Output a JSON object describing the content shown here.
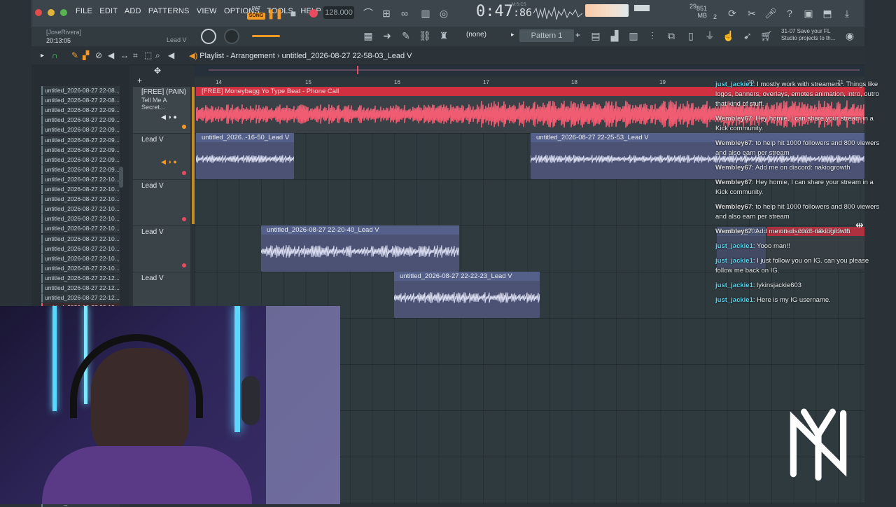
{
  "menu": [
    "FILE",
    "EDIT",
    "ADD",
    "PATTERNS",
    "VIEW",
    "OPTIONS",
    "TOOLS",
    "HELP"
  ],
  "transport": {
    "pat_label": "PAT",
    "song_label": "SONG",
    "tempo": "128.000",
    "time_main": "0:47",
    "time_sub": ":86",
    "time_unit": "M:S:CS"
  },
  "memory": {
    "cpu": "29",
    "mb": "851 MB",
    "voices": "2"
  },
  "user": {
    "name": "[JoseRivera]",
    "clock": "20:13:05"
  },
  "channel_label": "Lead V",
  "pattern_selector": "Pattern 1",
  "snap_selector": "(none)",
  "hint_text": "31-07  Save your FL Studio projects to th...",
  "playlist": {
    "view": "Playlist - Arrangement",
    "project": "untitled_2026-08-27 22-58-03_Lead V"
  },
  "browser_items": [
    "untitled_2026-08-27 22-08...",
    "untitled_2026-08-27 22-08...",
    "untitled_2026-08-27 22-09...",
    "untitled_2026-08-27 22-09...",
    "untitled_2026-08-27 22-09...",
    "untitled_2026-08-27 22-09...",
    "untitled_2026-08-27 22-09...",
    "untitled_2026-08-27 22-09...",
    "untitled_2026-08-27 22-09...",
    "untitled_2026-08-27 22-10...",
    "untitled_2026-08-27 22-10...",
    "untitled_2026-08-27 22-10...",
    "untitled_2026-08-27 22-10...",
    "untitled_2026-08-27 22-10...",
    "untitled_2026-08-27 22-10...",
    "untitled_2026-08-27 22-10...",
    "untitled_2026-08-27 22-10...",
    "untitled_2026-08-27 22-10...",
    "untitled_2026-08-27 22-10...",
    "untitled_2026-08-27 22-12...",
    "untitled_2026-08-27 22-12...",
    "untitled_2026-08-27 22-12...",
    "untitled_2026-08-27 22-12..."
  ],
  "browser_bottom_item": "untitled_2026-08-27 22-16...",
  "track_headers": [
    {
      "name": "[FREE] (PAIN)",
      "sub": "Tell Me A Secret..."
    },
    {
      "name": "Lead V",
      "sub": ""
    },
    {
      "name": "Lead V",
      "sub": ""
    },
    {
      "name": "Lead V",
      "sub": ""
    },
    {
      "name": "Lead V",
      "sub": ""
    }
  ],
  "ruler_labels": [
    "14",
    "15",
    "16",
    "17",
    "18",
    "19",
    "20",
    "21"
  ],
  "clips": {
    "beat": "[FREE] Moneybagg Yo Type Beat - Phone Call",
    "lead1": "untitled_2026..-16-50_Lead V",
    "lead2": "untitled_2026-08-27 22-25-53_Lead V",
    "lead3": "untitled_2026-08-27 22-20-40_Lead V",
    "lead4": "untitled_2026-08-27 22-22-23_Lead V",
    "ghost1": "untitled_201",
    "ghost2": "untitled_2026-08-27 22-01"
  },
  "chat": [
    {
      "user": "just_jackie1",
      "text": "I mostly work with streamers . Things like logos, banners, overlays, emotes animation, intro, outro that kind of stuff.",
      "kind": "j"
    },
    {
      "user": "Wembley67",
      "text": "Hey homie, I can share your stream in a Kick community.",
      "kind": "w"
    },
    {
      "user": "Wembley67",
      "text": "to help hit 1000 followers and 800 viewers and also earn per stream",
      "kind": "w"
    },
    {
      "user": "Wembley67",
      "text": "Add me on discord: nakiogrowth",
      "kind": "w"
    },
    {
      "user": "Wembley67",
      "text": "Hey homie, I can share your stream in a Kick community.",
      "kind": "w"
    },
    {
      "user": "Wembley67",
      "text": "to help hit 1000 followers and 800 viewers and also earn per stream",
      "kind": "w"
    },
    {
      "user": "Wembley67",
      "text": "Add me on discord: nakiogrowth",
      "kind": "w"
    },
    {
      "user": "just_jackie1",
      "text": "Yooo man!!",
      "kind": "j"
    },
    {
      "user": "just_jackie1",
      "text": "I just follow you on IG. can you please follow me back on IG.",
      "kind": "j"
    },
    {
      "user": "just_jackie1",
      "text": "lykinsjackie603",
      "kind": "j"
    },
    {
      "user": "just_jackie1",
      "text": "Here is my IG username.",
      "kind": "j"
    }
  ],
  "colors": {
    "accent": "#f39a26",
    "clip_red": "#d03040",
    "clip_blue": "#55608a",
    "chat_user": "#59d3ea"
  }
}
